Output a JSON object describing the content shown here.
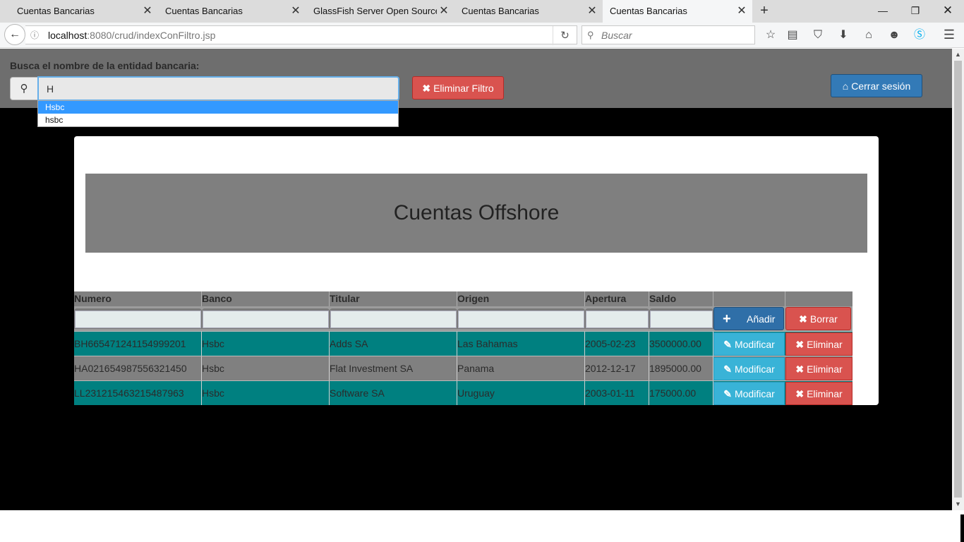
{
  "browser": {
    "tabs": [
      {
        "label": "Cuentas Bancarias",
        "active": false
      },
      {
        "label": "Cuentas Bancarias",
        "active": false
      },
      {
        "label": "GlassFish Server Open Source ...",
        "active": false
      },
      {
        "label": "Cuentas Bancarias",
        "active": false
      },
      {
        "label": "Cuentas Bancarias",
        "active": true
      }
    ],
    "url_host": "localhost",
    "url_path": ":8080/crud/indexConFiltro.jsp",
    "search_placeholder": "Buscar",
    "icons": [
      "back-arrow-icon",
      "info-icon",
      "reload-icon",
      "search-icon",
      "bookmark-star-icon",
      "reader-view-icon",
      "pocket-icon",
      "download-icon",
      "home-icon",
      "smiley-icon",
      "skype-icon",
      "menu-icon"
    ]
  },
  "filter": {
    "label": "Busca el nombre de la entidad bancaria:",
    "value": "H",
    "clear_button": "Eliminar Filtro",
    "logout_button": "Cerrar sesión",
    "suggestions": [
      "Hsbc",
      "hsbc"
    ],
    "selected_suggestion": "Hsbc"
  },
  "panel": {
    "title": "Cuentas Offshore"
  },
  "table": {
    "headers": [
      "Numero",
      "Banco",
      "Titular",
      "Origen",
      "Apertura",
      "Saldo"
    ],
    "add_button": "Añadir",
    "clear_button": "Borrar",
    "modify_button": "Modificar",
    "delete_button": "Eliminar",
    "rows": [
      {
        "numero": "BH665471241154999201",
        "banco": "Hsbc",
        "titular": "Adds SA",
        "origen": "Las Bahamas",
        "apertura": "2005-02-23",
        "saldo": "3500000.00"
      },
      {
        "numero": "HA021654987556321450",
        "banco": "Hsbc",
        "titular": "Flat Investment SA",
        "origen": "Panama",
        "apertura": "2012-12-17",
        "saldo": "1895000.00"
      },
      {
        "numero": "LL231215463215487963",
        "banco": "Hsbc",
        "titular": "Software SA",
        "origen": "Uruguay",
        "apertura": "2003-01-11",
        "saldo": "175000.00"
      }
    ]
  },
  "colors": {
    "teal_row": "#008080",
    "gray_row": "#808080",
    "danger": "#d9534f",
    "primary": "#337ab7",
    "info": "#39b3d7"
  }
}
